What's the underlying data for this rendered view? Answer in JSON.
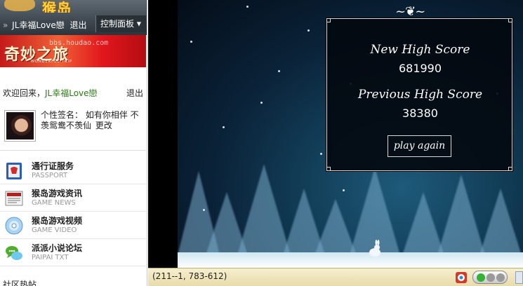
{
  "sidebar": {
    "logo": {
      "text": "猴岛",
      "domain": "BBS.HOUDAO.COM"
    },
    "user_bar": {
      "separator": "»",
      "username": "JL幸福Love戀",
      "logout": "退出",
      "control_panel": "控制面板"
    },
    "banner": {
      "title": "奇妙之旅",
      "subtitle": "WONDERFUL TRIP",
      "watermark": "bbs.houdao.com"
    },
    "welcome": {
      "prefix": "欢迎回来，",
      "username": "JL幸福Love戀",
      "logout": "退出"
    },
    "signature": {
      "label": "个性签名：",
      "text": "如有你相伴  不羡鸳鸯不羡仙",
      "edit": "更改"
    },
    "services": [
      {
        "title": "通行证服务",
        "subtitle": "PASSPORT",
        "icon": "passport-icon",
        "color": "#2b5fb3"
      },
      {
        "title": "猴岛游戏资讯",
        "subtitle": "GAME NEWS",
        "icon": "news-icon",
        "color": "#b32020"
      },
      {
        "title": "猴岛游戏视频",
        "subtitle": "GAME VIDEO",
        "icon": "video-disc-icon",
        "color": "#3b8ed0"
      },
      {
        "title": "派派小说论坛",
        "subtitle": "PAIPAI TXT",
        "icon": "chat-bubbles-icon",
        "color": "#4fae2c"
      }
    ],
    "hot_posts": "社区热帖"
  },
  "game": {
    "new_high_score_label": "New High Score",
    "new_high_score": "681990",
    "previous_high_score_label": "Previous High Score",
    "previous_high_score": "38380",
    "play_again": "play again"
  },
  "statusbar": {
    "coords": "(211--1, 783-612)"
  },
  "colors": {
    "top_bar": "#3f4850",
    "banner_red": "#e2171d",
    "username_green": "#2f7a18",
    "statusbar_bg": "#f6efcf",
    "game_sky": "#0a2238"
  }
}
